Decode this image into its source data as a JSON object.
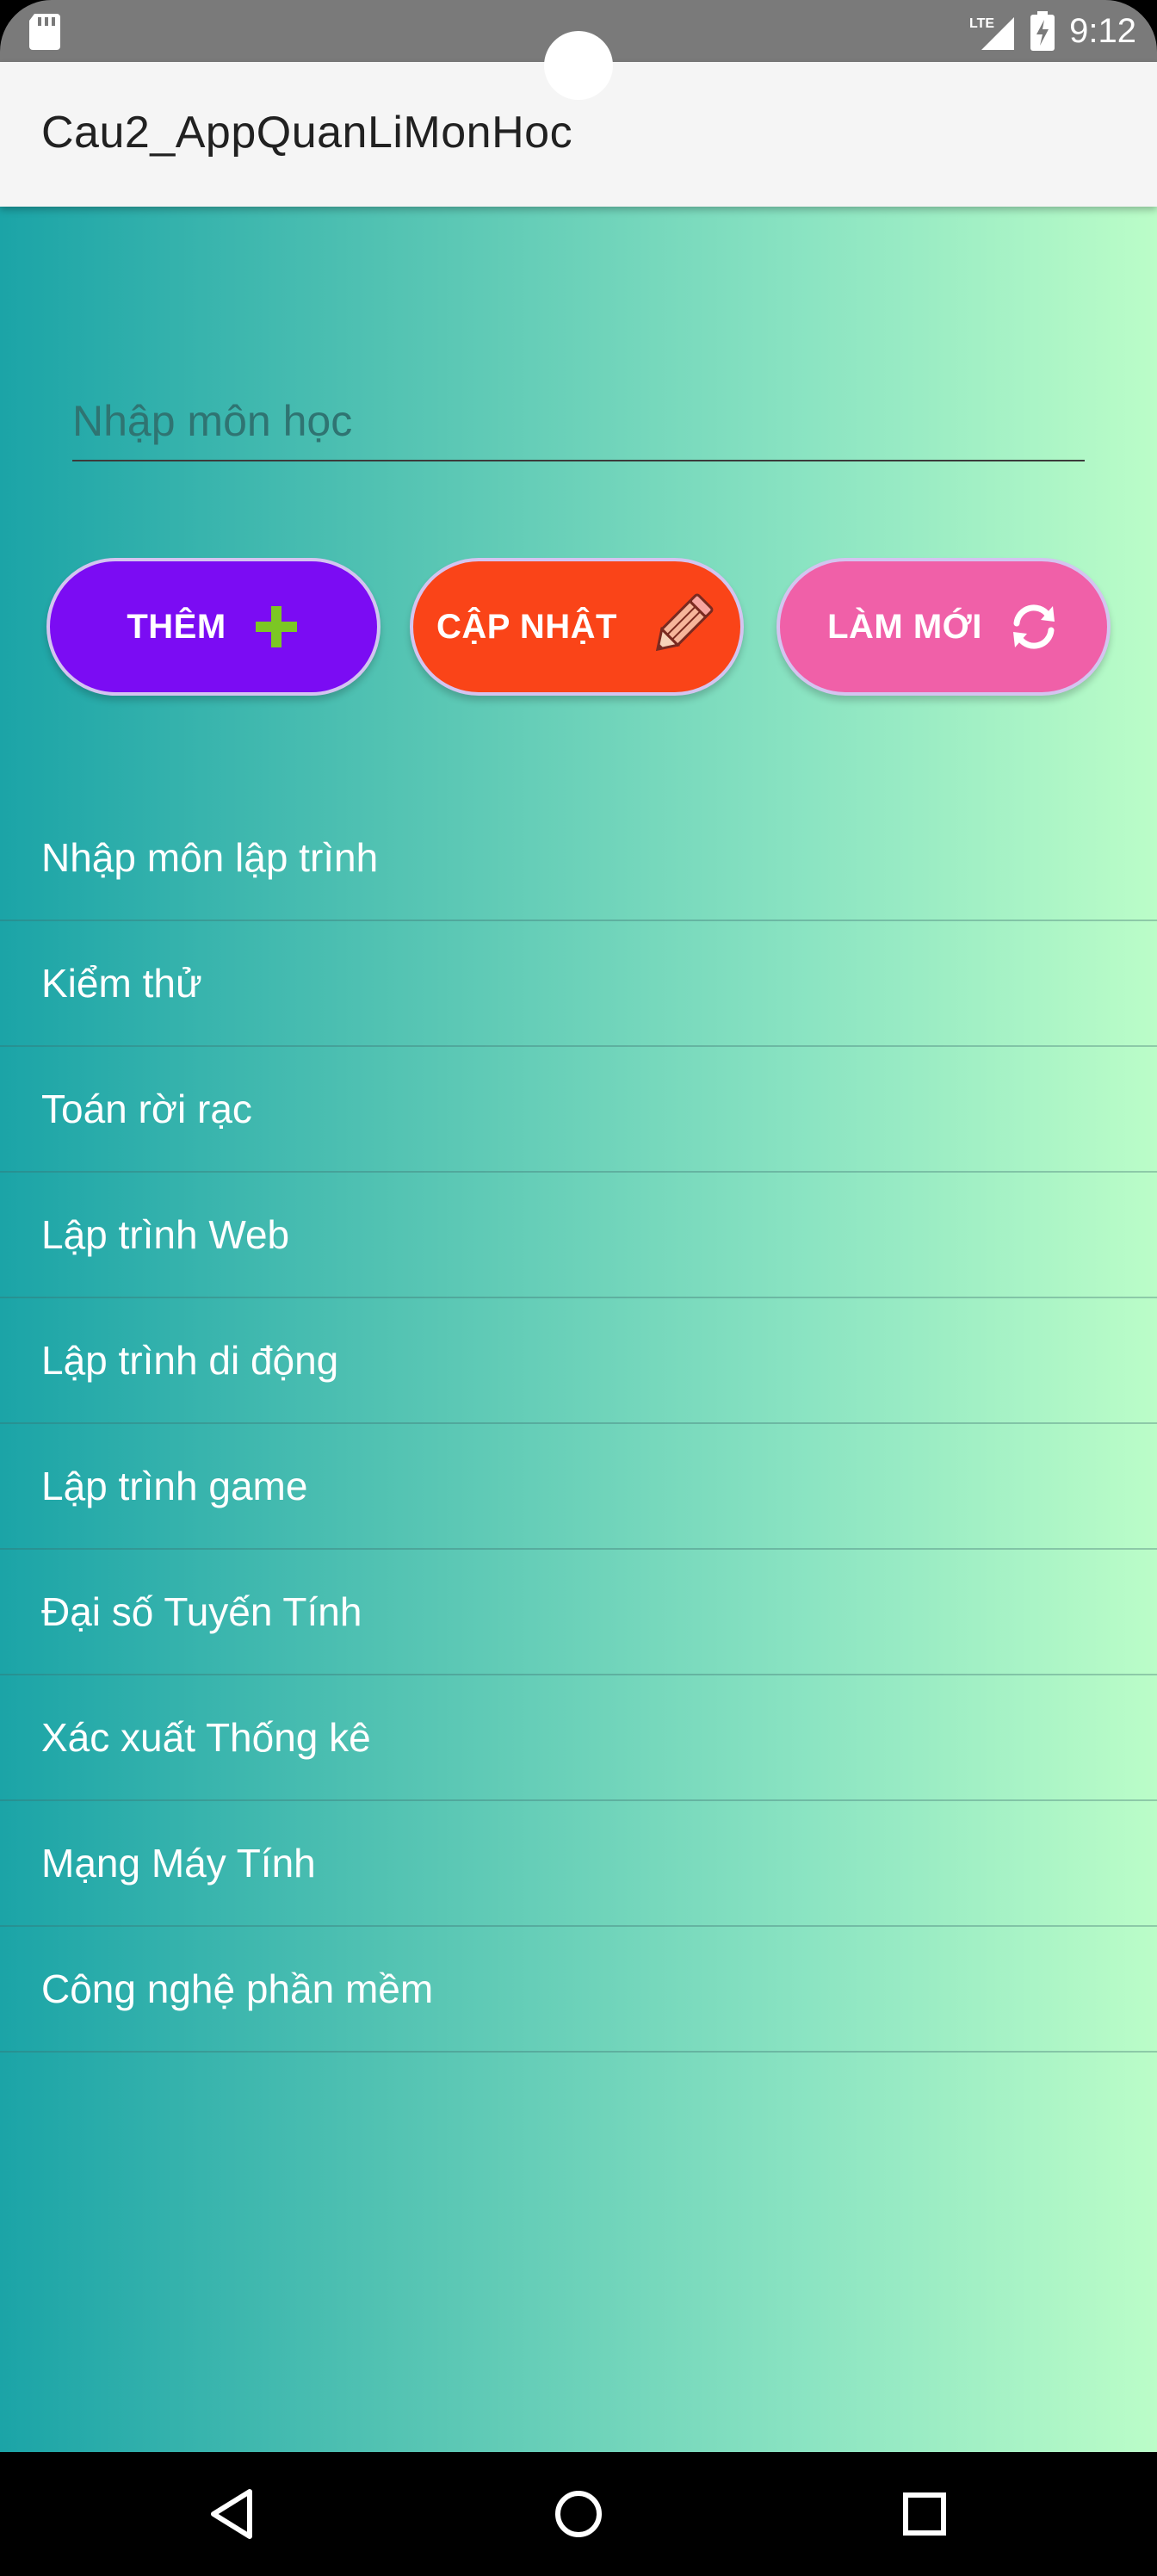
{
  "status_bar": {
    "time": "9:12",
    "network_label": "LTE",
    "icons": [
      "sd-card-icon",
      "lte-signal-icon",
      "battery-charging-icon"
    ]
  },
  "app_bar": {
    "title": "Cau2_AppQuanLiMonHoc"
  },
  "subject_input": {
    "placeholder": "Nhập môn học",
    "value": ""
  },
  "buttons": {
    "add": {
      "label": "THÊM",
      "color": "#7b0cf3",
      "icon": "plus-icon",
      "icon_color": "#7cc724"
    },
    "update": {
      "label": "CẬP NHẬT",
      "color": "#fa4418",
      "icon": "pencil-icon"
    },
    "refresh": {
      "label": "LÀM MỚI",
      "color": "#f060a8",
      "icon": "refresh-icon"
    }
  },
  "subjects": [
    "Nhập môn lập trình",
    "Kiểm thử",
    "Toán rời rạc",
    "Lập trình Web",
    "Lập trình di động",
    "Lập trình game",
    "Đại số Tuyến Tính",
    "Xác xuất Thống kê",
    "Mạng Máy Tính",
    "Công nghệ phần mềm"
  ],
  "nav_bar": {
    "icons": [
      "back-icon",
      "home-icon",
      "recent-apps-icon"
    ]
  },
  "colors": {
    "gradient_start": "#1ba4a7",
    "gradient_end": "#bbfdc8",
    "app_bar": "#f5f5f5"
  }
}
